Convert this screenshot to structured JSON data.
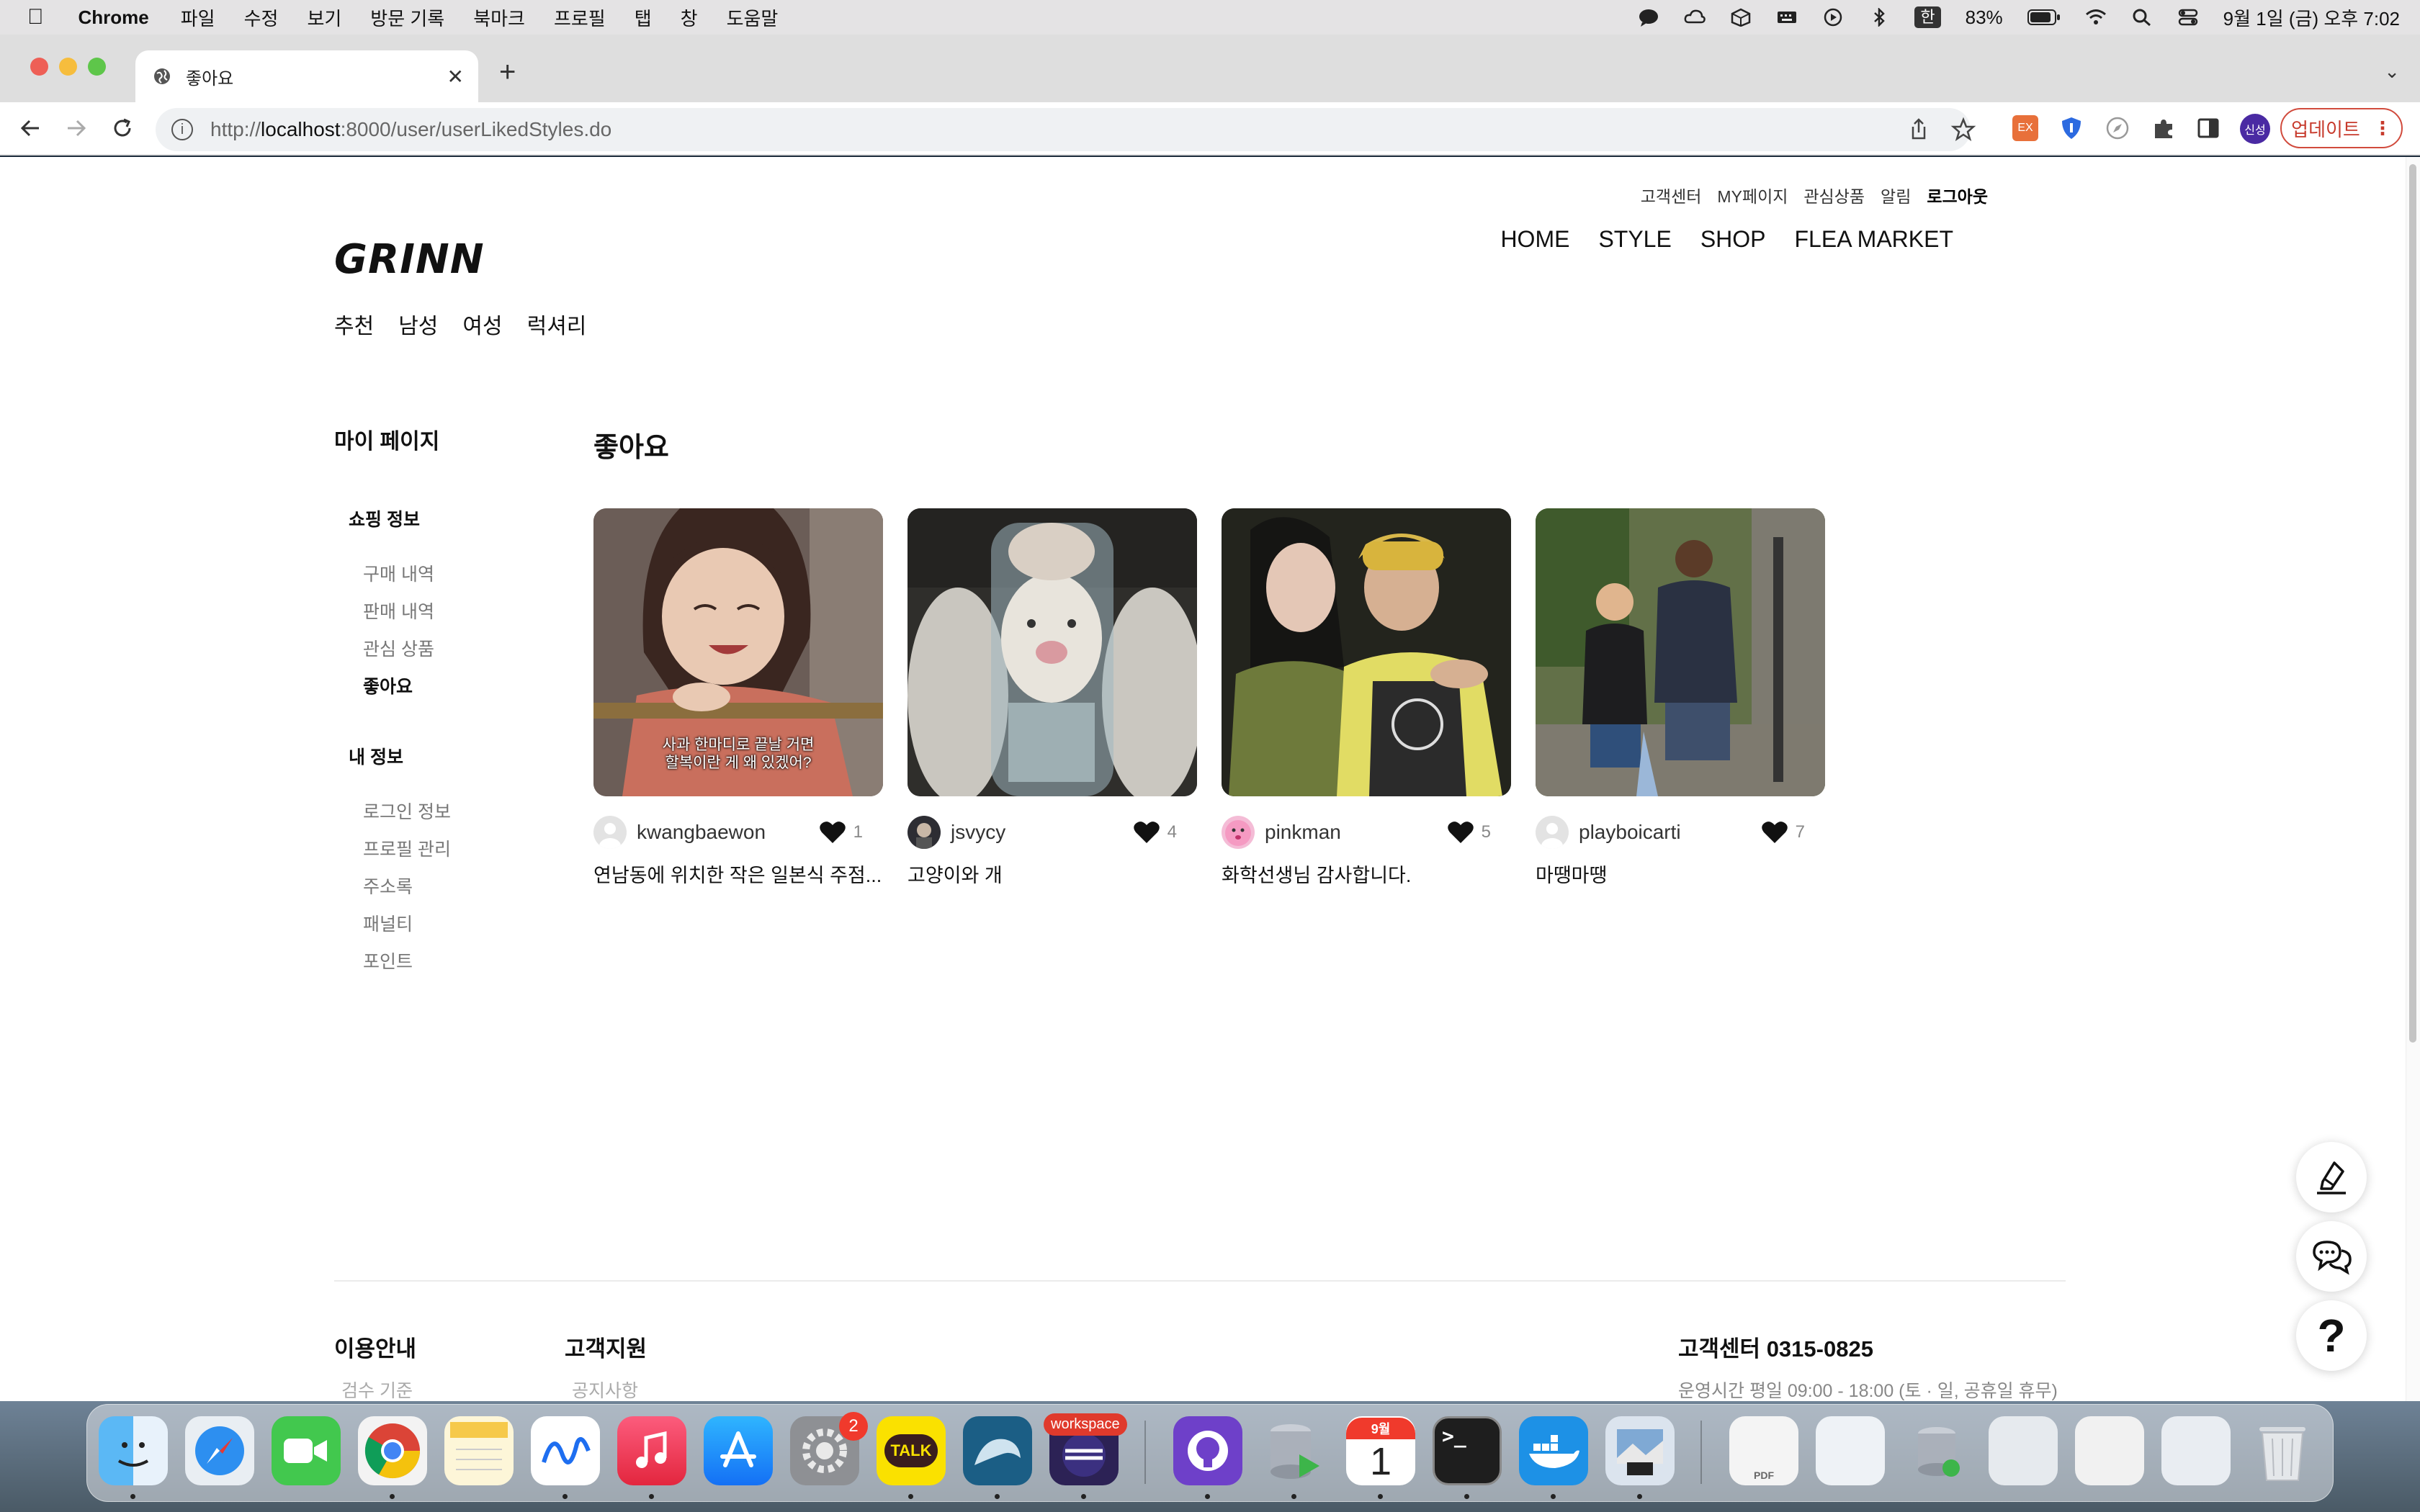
{
  "menubar": {
    "app": "Chrome",
    "items": [
      "파일",
      "수정",
      "보기",
      "방문 기록",
      "북마크",
      "프로필",
      "탭",
      "창",
      "도움말"
    ],
    "input_method": "한",
    "battery": "83%",
    "datetime": "9월 1일 (금) 오후 7:02"
  },
  "browser": {
    "tab_title": "좋아요",
    "url_prefix": "http://",
    "url_host": "localhost",
    "url_rest": ":8000/user/userLikedStyles.do",
    "update_label": "업데이트",
    "profile_label": "신성"
  },
  "header": {
    "util_links": [
      "고객센터",
      "MY페이지",
      "관심상품",
      "알림"
    ],
    "logout": "로그아웃",
    "logo": "GRINN",
    "main_nav": [
      "HOME",
      "STYLE",
      "SHOP",
      "FLEA MARKET"
    ],
    "categories": [
      "추천",
      "남성",
      "여성",
      "럭셔리"
    ]
  },
  "sidebar": {
    "title": "마이 페이지",
    "groups": [
      {
        "label": "쇼핑 정보",
        "items": [
          "구매 내역",
          "판매 내역",
          "관심 상품",
          "좋아요"
        ]
      },
      {
        "label": "내 정보",
        "items": [
          "로그인 정보",
          "프로필 관리",
          "주소록",
          "패널티",
          "포인트"
        ]
      }
    ],
    "active": "좋아요"
  },
  "content": {
    "title": "좋아요",
    "cards": [
      {
        "user": "kwangbaewon",
        "likes": "1",
        "caption": "연남동에 위치한 작은 일본식 주점...",
        "subtitle_line1": "사과 한마디로 끝날 거면",
        "subtitle_line2": "할복이란 게 왜 있겠어?"
      },
      {
        "user": "jsvycy",
        "likes": "4",
        "caption": "고양이와 개"
      },
      {
        "user": "pinkman",
        "likes": "5",
        "caption": "화학선생님 감사합니다."
      },
      {
        "user": "playboicarti",
        "likes": "7",
        "caption": "마땡마땡"
      }
    ]
  },
  "footer": {
    "col1_title": "이용안내",
    "col1_item": "검수 기준",
    "col2_title": "고객지원",
    "col2_item": "공지사항",
    "cs_title": "고객센터 0315-0825",
    "cs_hours": "운영시간 평일 09:00 - 18:00 (토 · 일, 공휴일 휴무)"
  },
  "dock": {
    "badge_settings": "2",
    "kakao_label": "TALK",
    "eclipse_label": "workspace",
    "calendar_month": "9월",
    "calendar_day": "1",
    "terminal_label": ">_",
    "pdf_label": "PDF"
  }
}
